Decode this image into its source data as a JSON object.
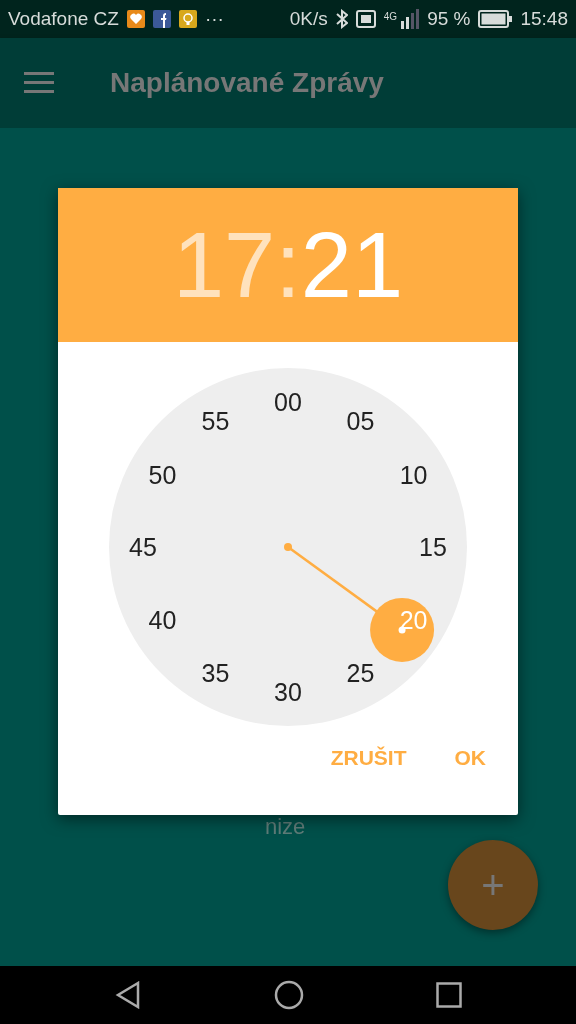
{
  "status_bar": {
    "carrier": "Vodafone CZ",
    "more": "···",
    "speed": "0K/s",
    "network": "4G",
    "battery": "95 %",
    "time": "15:48"
  },
  "app_bar": {
    "title": "Naplánované Zprávy"
  },
  "background_text": "nize",
  "time_picker": {
    "hours": {
      "text": "17",
      "selected": false
    },
    "separator": ":",
    "minutes": {
      "text": "21",
      "selected": true
    },
    "dial": [
      "00",
      "05",
      "10",
      "15",
      "20",
      "25",
      "30",
      "35",
      "40",
      "45",
      "50",
      "55"
    ],
    "buttons": [
      "ZRUŠIT",
      "OK"
    ]
  },
  "fab": {
    "label": "+"
  }
}
